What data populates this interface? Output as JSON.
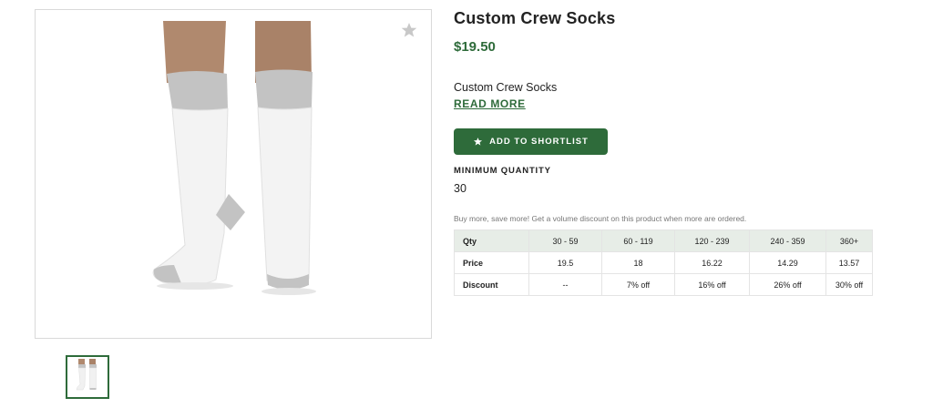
{
  "product": {
    "title": "Custom Crew Socks",
    "price": "$19.50",
    "description": "Custom Crew Socks",
    "read_more_label": "READ MORE",
    "shortlist_label": "ADD TO SHORTLIST",
    "min_quantity_label": "MINIMUM QUANTITY",
    "min_quantity_value": "30",
    "volume_note": "Buy more, save more! Get a volume discount on this product when more are ordered."
  },
  "gallery": {
    "main_image": "crew-socks-photo",
    "thumbnail": "crew-socks-thumbnail",
    "favorite_icon": "star-icon"
  },
  "pricing_table": {
    "rows": [
      {
        "label": "Qty",
        "cells": [
          "30 - 59",
          "60 - 119",
          "120 - 239",
          "240 - 359",
          "360+"
        ]
      },
      {
        "label": "Price",
        "cells": [
          "19.5",
          "18",
          "16.22",
          "14.29",
          "13.57"
        ]
      },
      {
        "label": "Discount",
        "cells": [
          "--",
          "7% off",
          "16% off",
          "26% off",
          "30% off"
        ]
      }
    ]
  },
  "colors": {
    "brand_green": "#2e6b3a",
    "table_header_bg": "#e7ede7"
  }
}
